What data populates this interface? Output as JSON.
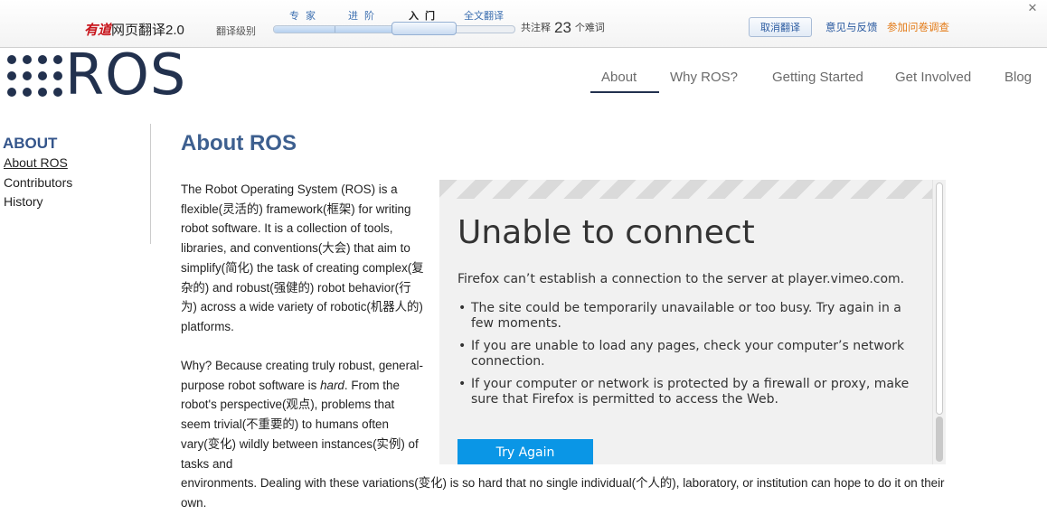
{
  "youdao_bar": {
    "brand": "有道",
    "brand_rest": "网页翻译2.0",
    "level_label": "翻译级别",
    "levels": {
      "expert": "专 家",
      "advanced": "进 阶",
      "basic": "入 门",
      "full": "全文翻译"
    },
    "count_prefix": "共注释",
    "count": "23",
    "count_suffix": "个难词",
    "cancel_label": "取消翻译",
    "feedback_label": "意见与反馈",
    "survey_label": "参加问卷调查",
    "close_icon": "close-icon",
    "colors": {
      "brand": "#c8161d",
      "link": "#2a5aa0",
      "survey": "#e37a16"
    }
  },
  "logo": {
    "word": "ROS",
    "icon": "ros-dots-logo-icon",
    "color": "#22314e"
  },
  "nav": {
    "items": [
      {
        "label": "About"
      },
      {
        "label": "Why ROS?"
      },
      {
        "label": "Getting Started"
      },
      {
        "label": "Get Involved"
      },
      {
        "label": "Blog"
      }
    ],
    "active": "About"
  },
  "sidebar": {
    "heading": "ABOUT",
    "links": [
      {
        "label": "About ROS"
      },
      {
        "label": "Contributors"
      },
      {
        "label": "History"
      }
    ]
  },
  "main": {
    "title": "About ROS",
    "para1": "The Robot Operating System (ROS) is a flexible(灵活的) framework(框架) for writing robot software. It is a collection of tools, libraries, and conventions(大会) that aim to simplify(简化) the task of creating complex(复杂的) and robust(强健的) robot behavior(行为) across a wide variety of robotic(机器人的) platforms.",
    "para2_start": "Why? Because creating truly robust, general-purpose robot software is ",
    "para2_em": "hard",
    "para2_end": ". From the robot's perspective(观点), problems that seem trivial(不重要的) to humans often vary(变化) wildly between instances(实例) of tasks and",
    "para3": "environments. Dealing with these variations(变化) is so hard that no single individual(个人的), laboratory, or institution can hope to do it on their own.",
    "title_color": "#3d5f8f"
  },
  "error_frame": {
    "title": "Unable to connect",
    "description": "Firefox can’t establish a connection to the server at player.vimeo.com.",
    "bullets": [
      "The site could be temporarily unavailable or too busy. Try again in a few moments.",
      "If you are unable to load any pages, check your computer’s network connection.",
      "If your computer or network is protected by a firewall or proxy, make sure that Firefox is permitted to access the Web."
    ],
    "try_again_label": "Try Again",
    "button_color": "#0a96e6"
  }
}
